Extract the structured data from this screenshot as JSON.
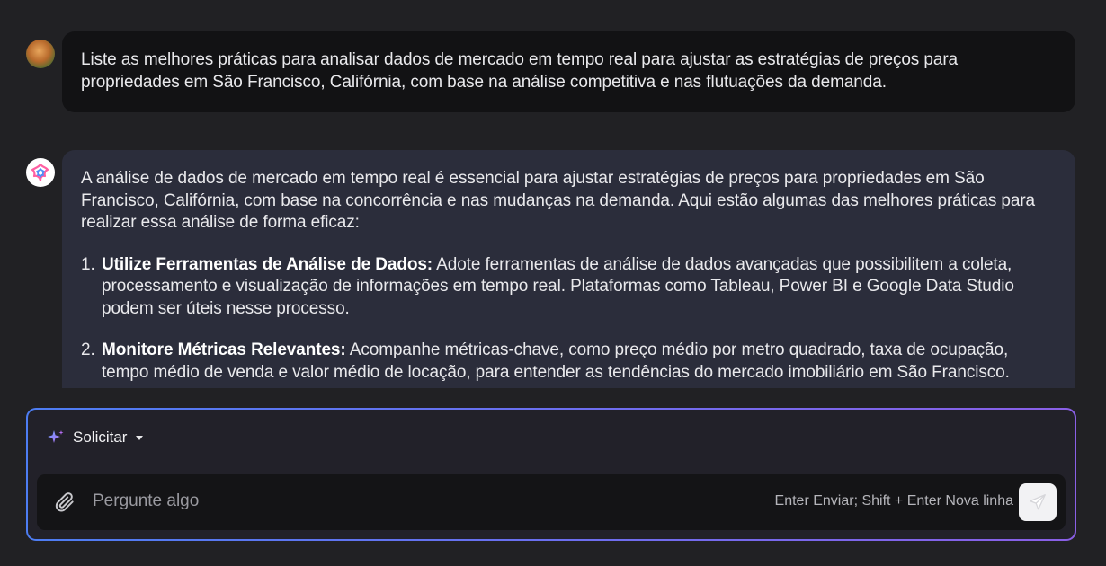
{
  "conversation": {
    "user_message": "Liste as melhores práticas para analisar dados de mercado em tempo real para ajustar as estratégias de preços para propriedades em São Francisco, Califórnia, com base na análise competitiva e nas flutuações da demanda.",
    "assistant_intro": "A análise de dados de mercado em tempo real é essencial para ajustar estratégias de preços para propriedades em São Francisco, Califórnia, com base na concorrência e nas mudanças na demanda. Aqui estão algumas das melhores práticas para realizar essa análise de forma eficaz:",
    "items": [
      {
        "number": "1.",
        "title": "Utilize Ferramentas de Análise de Dados:",
        "text": "Adote ferramentas de análise de dados avançadas que possibilitem a coleta, processamento e visualização de informações em tempo real. Plataformas como Tableau, Power BI e Google Data Studio podem ser úteis nesse processo."
      },
      {
        "number": "2.",
        "title": "Monitore Métricas Relevantes:",
        "text": "Acompanhe métricas-chave, como preço médio por metro quadrado, taxa de ocupação, tempo médio de venda e valor médio de locação, para entender as tendências do mercado imobiliário em São Francisco."
      }
    ]
  },
  "composer": {
    "mode_label": "Solicitar",
    "input_placeholder": "Pergunte algo",
    "input_value": "",
    "hint": "Enter Enviar; Shift + Enter Nova linha"
  },
  "colors": {
    "background": "#212124",
    "user_bubble": "#121214",
    "assistant_bubble": "#2b2d3b",
    "composer_border_start": "#4d7df2",
    "composer_border_end": "#8a5fe6"
  }
}
